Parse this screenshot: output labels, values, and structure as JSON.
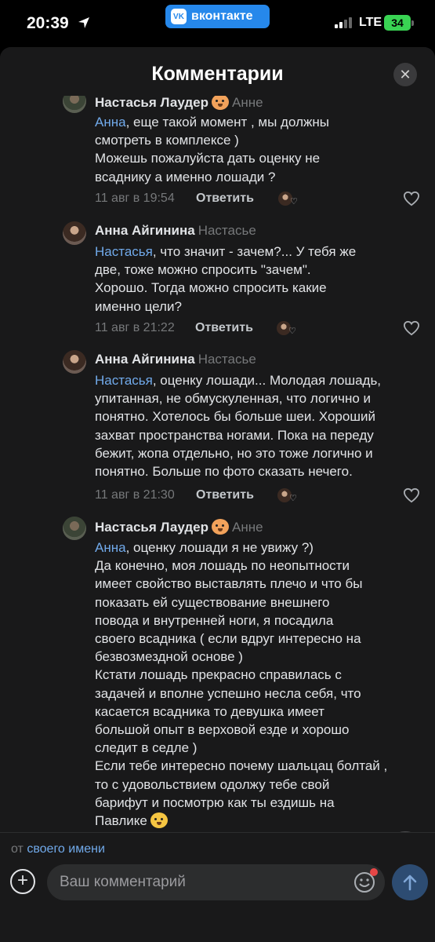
{
  "status_bar": {
    "time": "20:39",
    "app_badge": "вконтакте",
    "network": "LTE",
    "battery": "34"
  },
  "header": {
    "title": "Комментарии",
    "close_icon": "close-icon"
  },
  "comments": [
    {
      "author": "Настасья Лаудер",
      "emoji": "dog-face-emoji",
      "reply_to": "Анне",
      "mention": "Анна",
      "lines": [
        ", еще такой момент , мы должны",
        "смотреть в комплексе )",
        "Можешь пожалуйста дать оценку не",
        "всаднику а именно лошади ?"
      ],
      "date": "11 авг в 19:54",
      "reply_label": "Ответить"
    },
    {
      "author": "Анна Айгинина",
      "reply_to": "Настасье",
      "mention": "Настасья",
      "lines": [
        ", что значит - зачем?... У тебя же",
        "две, тоже можно спросить \"зачем\".",
        "Хорошо. Тогда можно спросить какие",
        "именно цели?"
      ],
      "date": "11 авг в 21:22",
      "reply_label": "Ответить"
    },
    {
      "author": "Анна Айгинина",
      "reply_to": "Настасье",
      "mention": "Настасья",
      "lines": [
        ", оценку лошади... Молодая лошадь,",
        "упитанная, не обмускуленная, что логично и",
        "понятно. Хотелось бы больше шеи. Хороший",
        "захват пространства ногами. Пока на переду",
        "бежит, жопа отдельно, но это тоже логично и",
        "понятно. Больше по фото сказать нечего."
      ],
      "date": "11 авг в 21:30",
      "reply_label": "Ответить"
    },
    {
      "author": "Настасья Лаудер",
      "emoji": "dog-face-emoji",
      "reply_to": "Анне",
      "mention": "Анна",
      "lines": [
        ", оценку лошади я не увижу ?)",
        "Да конечно, моя лошадь по неопытности",
        "имеет свойство выставлять плечо и что бы",
        "показать ей существование внешнего",
        "повода и внутренней ноги, я посадила",
        "своего всадника ( если вдруг интересно на",
        "безвозмездной основе )",
        "Кстати лошадь прекрасно справилась с",
        "задачей и вполне успешно несла себя, что",
        "касается всадника то девушка имеет",
        "большой опыт в верховой езде и хорошо",
        "следит в седле )",
        "Если тебе интересно почему шальцац болтай ,",
        "то с удовольствием одолжу тебе свой",
        "барифут и посмотрю как ты ездишь на",
        "Павлике"
      ],
      "trailing_emoji": "grinning-sweat-emoji"
    }
  ],
  "composer": {
    "from_prefix": "от",
    "from_link": "своего имени",
    "placeholder": "Ваш комментарий"
  }
}
